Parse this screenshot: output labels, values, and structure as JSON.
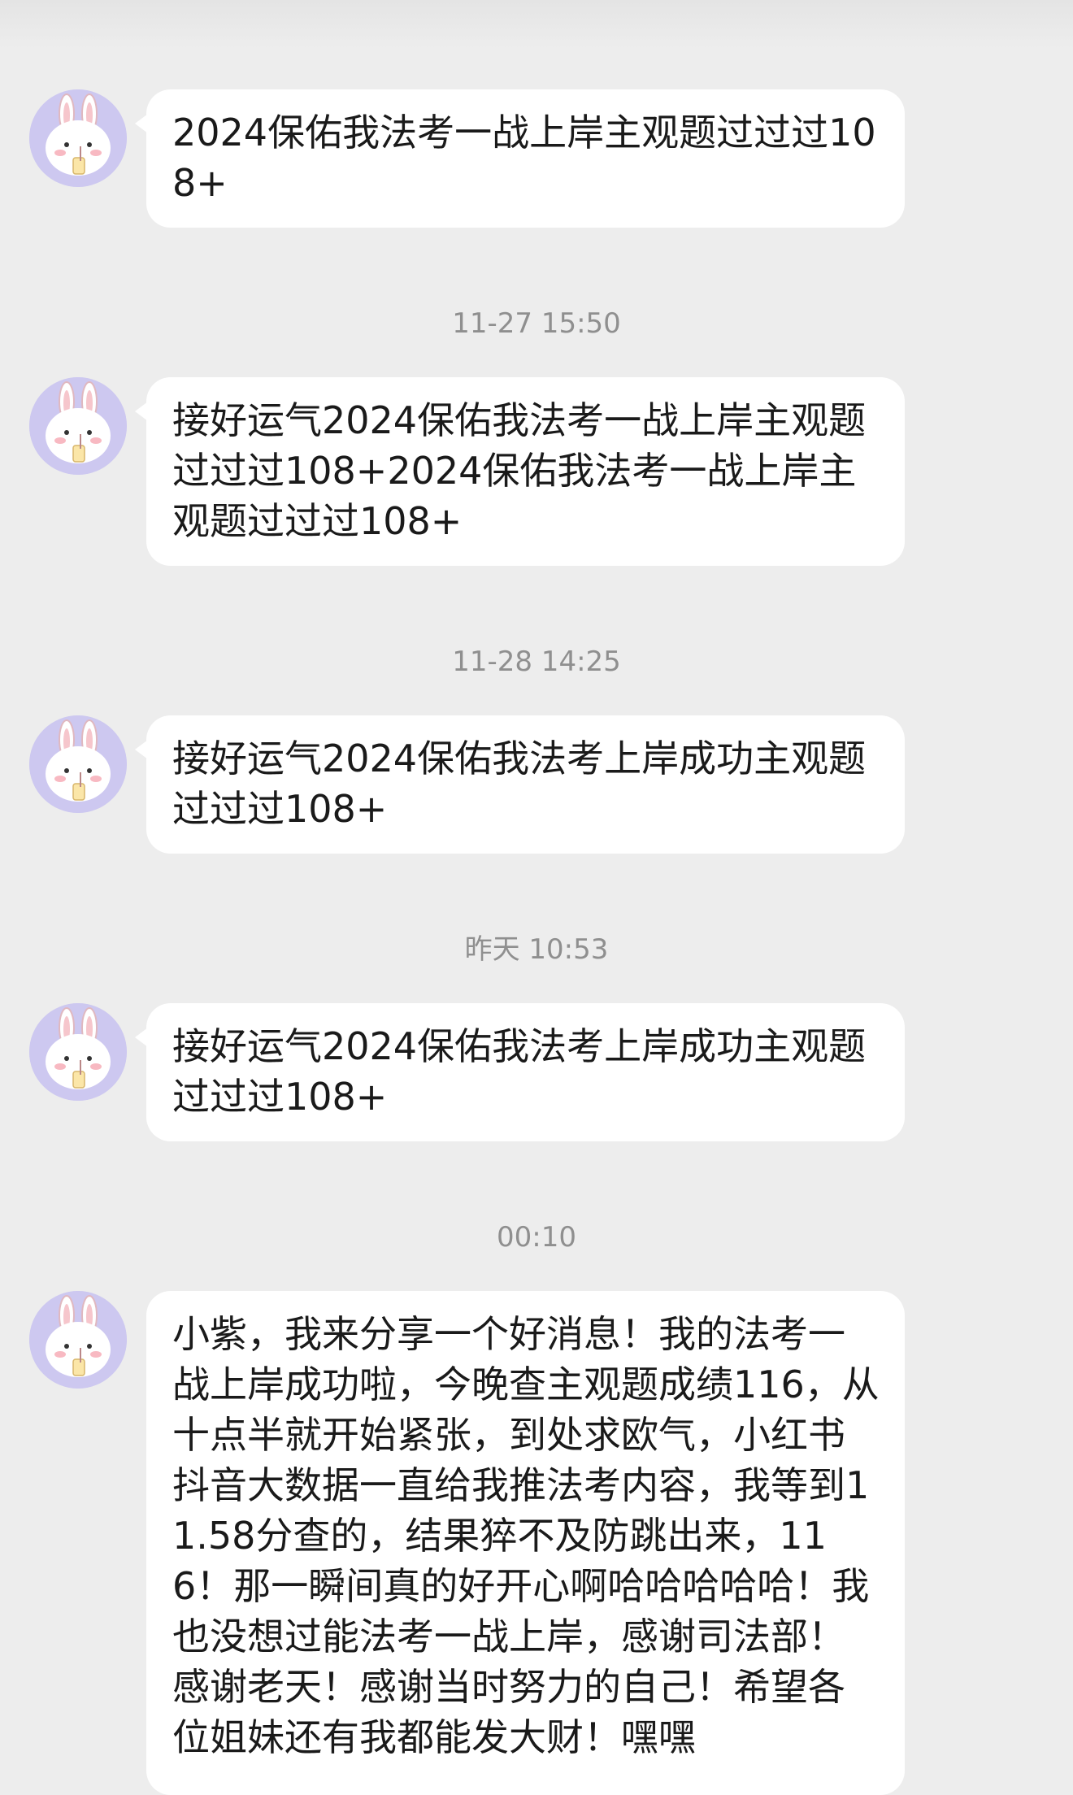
{
  "conversation": {
    "messages": [
      {
        "text": "2024保佑我法考一战上岸主观题过过过108+"
      },
      {
        "text": "接好运气2024保佑我法考一战上岸主观题过过过108+2024保佑我法考一战上岸主观题过过过108+"
      },
      {
        "text": "接好运气2024保佑我法考上岸成功主观题过过过108+"
      },
      {
        "text": "接好运气2024保佑我法考上岸成功主观题过过过108+"
      },
      {
        "text": "小紫，我来分享一个好消息！我的法考一战上岸成功啦，今晚查主观题成绩116，从十点半就开始紧张，到处求欧气，小红书抖音大数据一直给我推法考内容，我等到11.58分查的，结果猝不及防跳出来，116！那一瞬间真的好开心啊哈哈哈哈哈！我也没想过能法考一战上岸，感谢司法部！感谢老天！感谢当时努力的自己！希望各位姐妹还有我都能发大财！嘿嘿"
      }
    ],
    "timestamps": [
      "11-27 15:50",
      "11-28 14:25",
      "昨天 10:53",
      "00:10"
    ]
  },
  "avatar": {
    "icon": "bunny-avatar-icon",
    "bg_color": "#cdc8f0"
  },
  "colors": {
    "background": "#ededed",
    "bubble": "#ffffff",
    "timestamp": "#8f8f8f",
    "text": "#1a1a1a"
  }
}
